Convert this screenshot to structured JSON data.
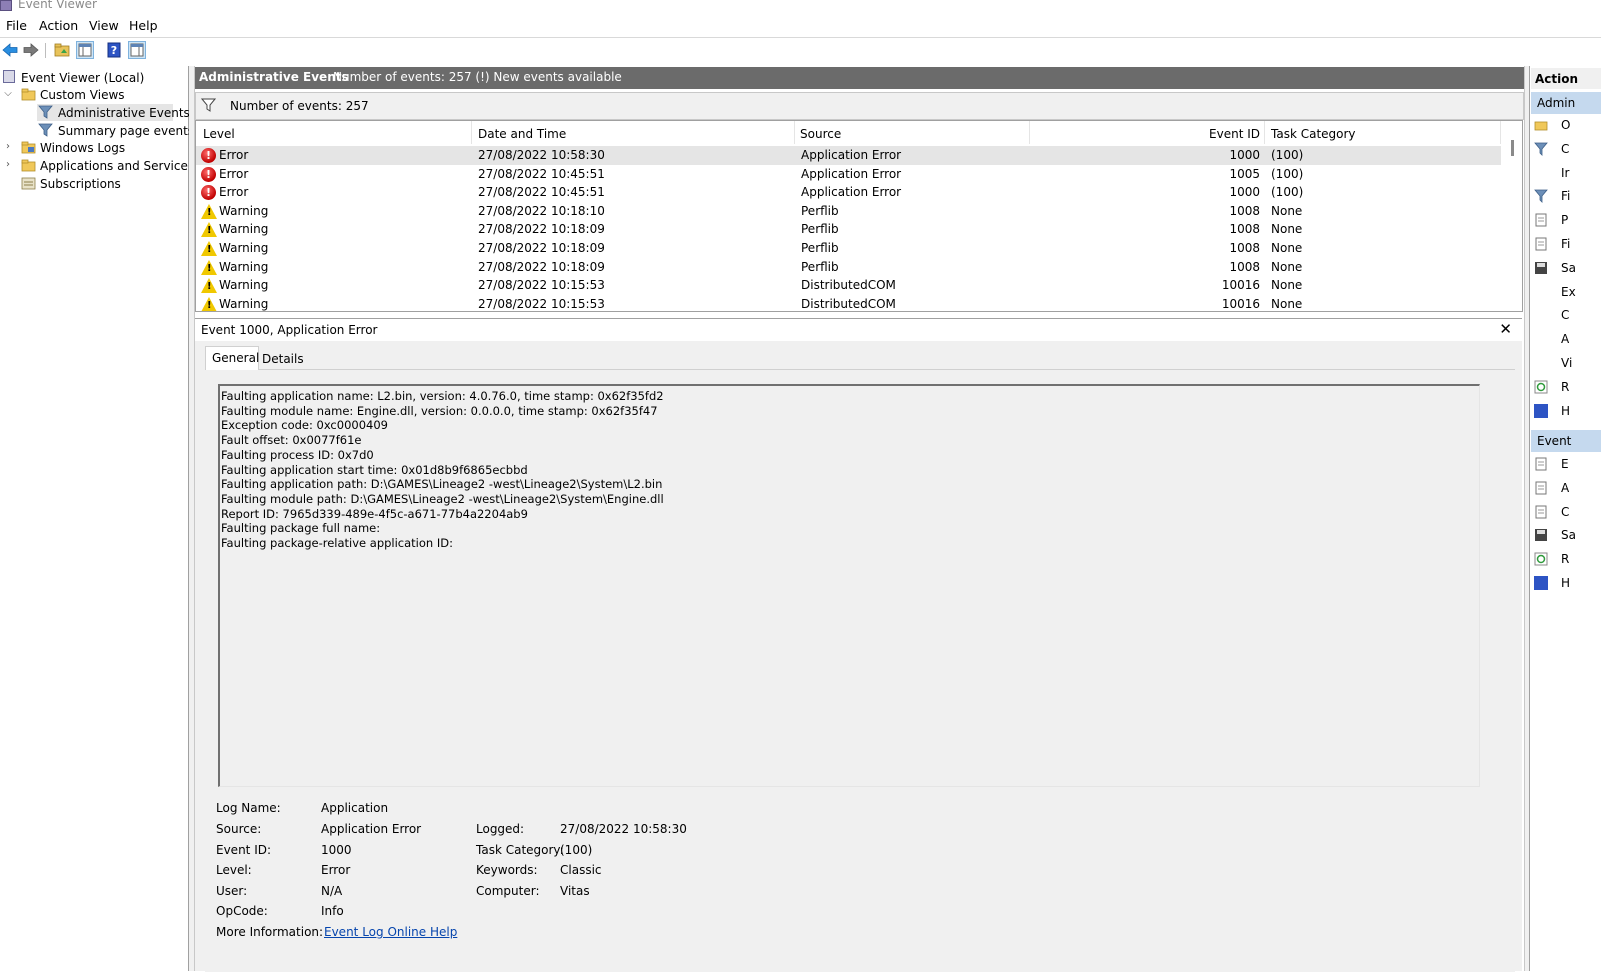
{
  "window": {
    "title": "Event Viewer"
  },
  "menu": [
    "File",
    "Action",
    "View",
    "Help"
  ],
  "tree": {
    "root": "Event Viewer (Local)",
    "custom_views": "Custom Views",
    "administrative_events": "Administrative Events",
    "summary_page_events": "Summary page events",
    "windows_logs": "Windows Logs",
    "apps_services": "Applications and Services Lo",
    "subscriptions": "Subscriptions"
  },
  "header": {
    "title": "Administrative Events",
    "info": "Number of events: 257 (!) New events available"
  },
  "filter": {
    "label": "Number of events: 257"
  },
  "columns": {
    "level": "Level",
    "datetime": "Date and Time",
    "source": "Source",
    "event_id": "Event ID",
    "task_category": "Task Category"
  },
  "events": [
    {
      "level": "Error",
      "datetime": "27/08/2022 10:58:30",
      "source": "Application Error",
      "event_id": "1000",
      "task": "(100)"
    },
    {
      "level": "Error",
      "datetime": "27/08/2022 10:45:51",
      "source": "Application Error",
      "event_id": "1005",
      "task": "(100)"
    },
    {
      "level": "Error",
      "datetime": "27/08/2022 10:45:51",
      "source": "Application Error",
      "event_id": "1000",
      "task": "(100)"
    },
    {
      "level": "Warning",
      "datetime": "27/08/2022 10:18:10",
      "source": "Perflib",
      "event_id": "1008",
      "task": "None"
    },
    {
      "level": "Warning",
      "datetime": "27/08/2022 10:18:09",
      "source": "Perflib",
      "event_id": "1008",
      "task": "None"
    },
    {
      "level": "Warning",
      "datetime": "27/08/2022 10:18:09",
      "source": "Perflib",
      "event_id": "1008",
      "task": "None"
    },
    {
      "level": "Warning",
      "datetime": "27/08/2022 10:18:09",
      "source": "Perflib",
      "event_id": "1008",
      "task": "None"
    },
    {
      "level": "Warning",
      "datetime": "27/08/2022 10:15:53",
      "source": "DistributedCOM",
      "event_id": "10016",
      "task": "None"
    },
    {
      "level": "Warning",
      "datetime": "27/08/2022 10:15:53",
      "source": "DistributedCOM",
      "event_id": "10016",
      "task": "None"
    }
  ],
  "detail": {
    "title": "Event 1000, Application Error",
    "close": "✕",
    "tabs": {
      "general": "General",
      "details": "Details"
    },
    "message": [
      "Faulting application name: L2.bin, version: 4.0.76.0, time stamp: 0x62f35fd2",
      "Faulting module name: Engine.dll, version: 0.0.0.0, time stamp: 0x62f35f47",
      "Exception code: 0xc0000409",
      "Fault offset: 0x0077f61e",
      "Faulting process ID: 0x7d0",
      "Faulting application start time: 0x01d8b9f6865ecbbd",
      "Faulting application path: D:\\GAMES\\Lineage2 -west\\Lineage2\\System\\L2.bin",
      "Faulting module path: D:\\GAMES\\Lineage2 -west\\Lineage2\\System\\Engine.dll",
      "Report ID: 7965d339-489e-4f5c-a671-77b4a2204ab9",
      "Faulting package full name: ",
      "Faulting package-relative application ID: "
    ],
    "fields": {
      "log_name_label": "Log Name:",
      "log_name": "Application",
      "source_label": "Source:",
      "source": "Application Error",
      "logged_label": "Logged:",
      "logged": "27/08/2022 10:58:30",
      "event_id_label": "Event ID:",
      "event_id": "1000",
      "task_category_label": "Task Category:",
      "task_category": "(100)",
      "level_label": "Level:",
      "level": "Error",
      "keywords_label": "Keywords:",
      "keywords": "Classic",
      "user_label": "User:",
      "user": "N/A",
      "computer_label": "Computer:",
      "computer": "Vitas",
      "opcode_label": "OpCode:",
      "opcode": "Info",
      "more_info_label": "More Information:",
      "more_info_link": "Event Log Online Help"
    }
  },
  "actions": {
    "title": "Action",
    "section1": "Admin",
    "items1": [
      "O",
      "C",
      "Ir",
      "Fi",
      "P",
      "Fi",
      "Sa",
      "Ex",
      "C",
      "A",
      "Vi",
      "R",
      "H"
    ],
    "section2": "Event",
    "items2": [
      "E",
      "A",
      "C",
      "Sa",
      "R",
      "H"
    ]
  },
  "colors": {
    "header_bg": "#6b6b6b",
    "error": "#c00000",
    "warning": "#f0c800",
    "link": "#0645ad"
  }
}
